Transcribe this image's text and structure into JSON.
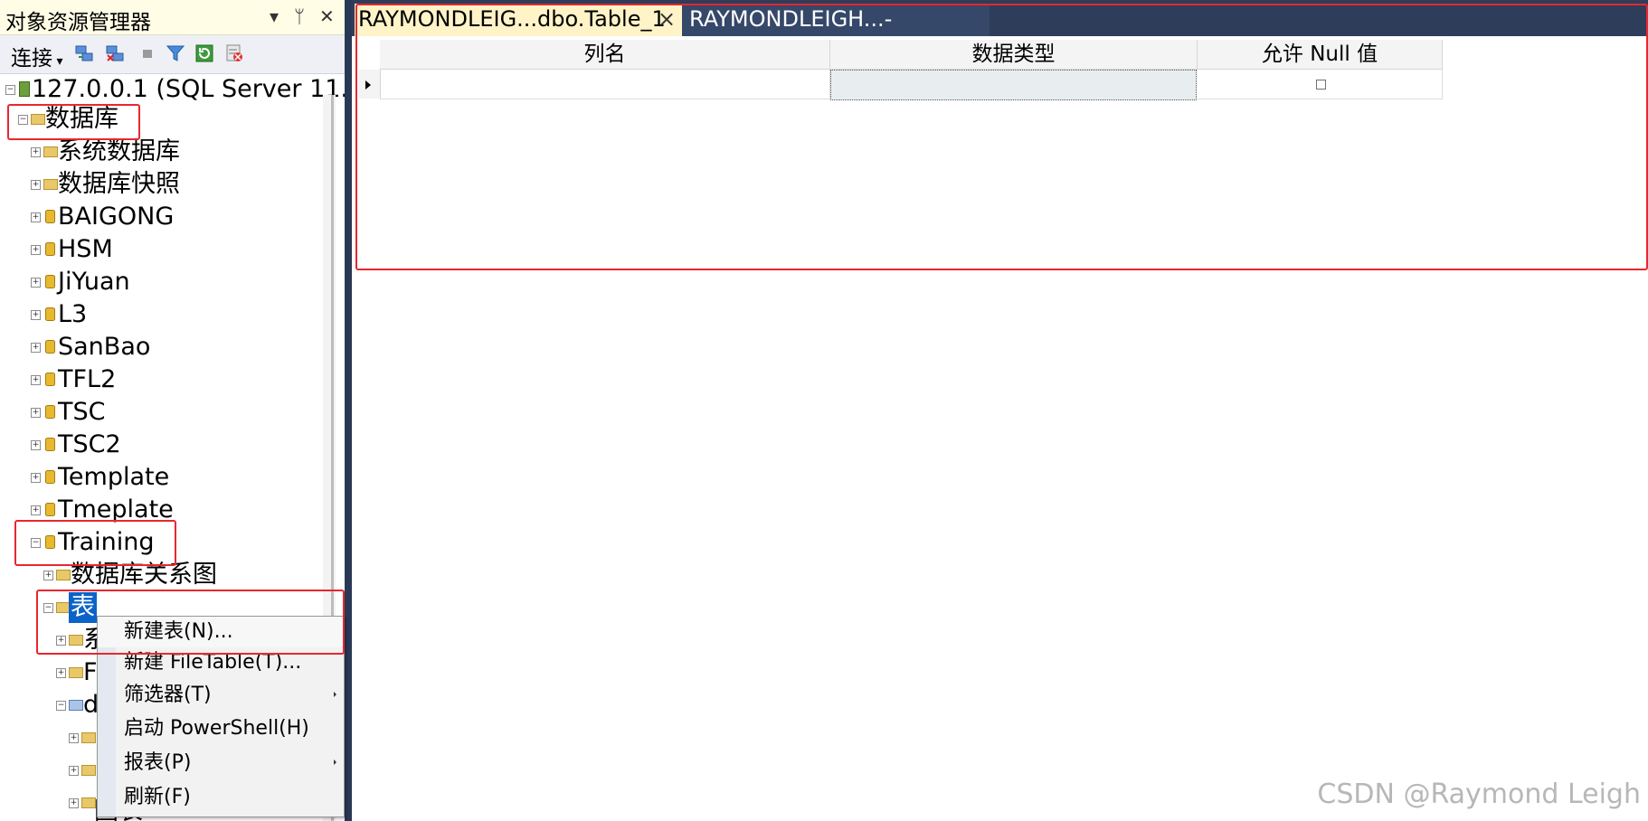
{
  "object_explorer": {
    "title": "对象资源管理器",
    "title_buttons": [
      "chevron-down-icon",
      "pin-icon",
      "close-icon"
    ],
    "toolbar": {
      "connect_label": "连接",
      "icons": [
        "connect-object-explorer-icon",
        "disconnect-icon",
        "stop-icon",
        "filter-icon",
        "refresh-icon",
        "activity-monitor-icon"
      ]
    },
    "tree": {
      "server": "127.0.0.1 (SQL Server 11.",
      "databases": "数据库",
      "system_databases": "系统数据库",
      "snapshots": "数据库快照",
      "dbs": [
        "BAIGONG",
        "HSM",
        "JiYuan",
        "L3",
        "SanBao",
        "TFL2",
        "TSC",
        "TSC2",
        "Template",
        "Tmeplate"
      ],
      "training": "Training",
      "diagrams": "数据库关系图",
      "tables": "表",
      "child_system": "系",
      "child_file": "F",
      "child_dbo": "d",
      "child_last": "图表"
    }
  },
  "context_menu": {
    "items": [
      {
        "label": "新建表(N)...",
        "submenu": false
      },
      {
        "label": "新建 FileTable(T)...",
        "submenu": false
      },
      {
        "label": "筛选器(T)",
        "submenu": true
      },
      {
        "label": "启动 PowerShell(H)",
        "submenu": false
      },
      {
        "label": "报表(P)",
        "submenu": true
      },
      {
        "label": "刷新(F)",
        "submenu": false
      }
    ]
  },
  "tabs": [
    {
      "label": "RAYMONDLEIG...dbo.Table_1",
      "close": "×",
      "active": true
    },
    {
      "label": "RAYMONDLEIGH...- dbo.Steel",
      "active": false
    }
  ],
  "table_designer": {
    "columns": [
      "列名",
      "数据类型",
      "允许 Null 值"
    ],
    "rows": [
      {
        "name": "",
        "type": "",
        "allow_null": false
      }
    ]
  },
  "watermark": "CSDN @Raymond Leigh",
  "colors": {
    "annotation": "#e8272f",
    "selection": "#0b63c9",
    "frame": "#293955"
  }
}
